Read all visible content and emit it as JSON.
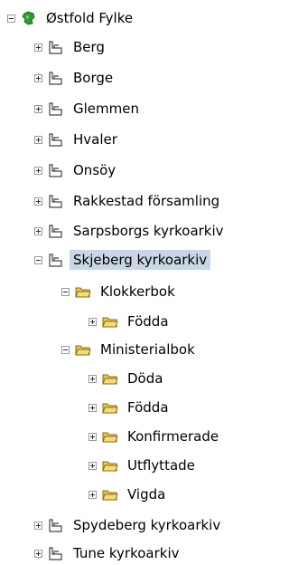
{
  "tree": {
    "root": {
      "label": "Østfold Fylke",
      "icon": "globe-icon",
      "expanded": true
    },
    "items": [
      {
        "label": "Berg",
        "icon": "archive-icon",
        "expanded": false
      },
      {
        "label": "Borge",
        "icon": "archive-icon",
        "expanded": false
      },
      {
        "label": "Glemmen",
        "icon": "archive-icon",
        "expanded": false
      },
      {
        "label": "Hvaler",
        "icon": "archive-icon",
        "expanded": false
      },
      {
        "label": "Onsöy",
        "icon": "archive-icon",
        "expanded": false
      },
      {
        "label": "Rakkestad församling",
        "icon": "archive-icon",
        "expanded": false
      },
      {
        "label": "Sarpsborgs kyrkoarkiv",
        "icon": "archive-icon",
        "expanded": false
      },
      {
        "label": "Skjeberg kyrkoarkiv",
        "icon": "archive-icon",
        "expanded": true,
        "selected": true,
        "children": [
          {
            "label": "Klokkerbok",
            "icon": "folder-icon",
            "expanded": true,
            "children": [
              {
                "label": "Födda",
                "icon": "folder-icon",
                "expanded": false
              }
            ]
          },
          {
            "label": "Ministerialbok",
            "icon": "folder-icon",
            "expanded": true,
            "children": [
              {
                "label": "Döda",
                "icon": "folder-icon",
                "expanded": false
              },
              {
                "label": "Födda",
                "icon": "folder-icon",
                "expanded": false
              },
              {
                "label": "Konfirmerade",
                "icon": "folder-icon",
                "expanded": false
              },
              {
                "label": "Utflyttade",
                "icon": "folder-icon",
                "expanded": false
              },
              {
                "label": "Vigda",
                "icon": "folder-icon",
                "expanded": false
              }
            ]
          }
        ]
      },
      {
        "label": "Spydeberg kyrkoarkiv",
        "icon": "archive-icon",
        "expanded": false
      },
      {
        "label": "Tune kyrkoarkiv",
        "icon": "archive-icon",
        "expanded": false
      }
    ]
  },
  "colors": {
    "selection": "#c9d6e5",
    "globe": "#2f9e2f",
    "folder": "#e7c84f"
  }
}
